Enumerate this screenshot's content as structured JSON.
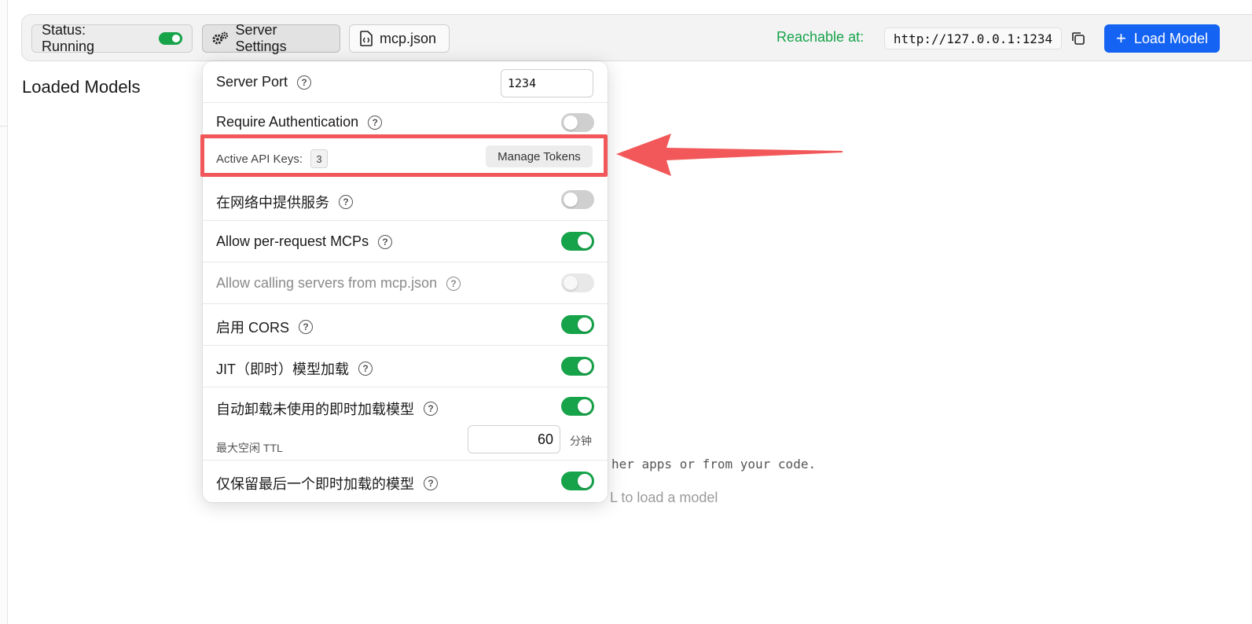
{
  "toolbar": {
    "status_label": "Status: Running",
    "server_settings_label": "Server Settings",
    "mcp_label": "mcp.json",
    "reachable_label": "Reachable at:",
    "url": "http://127.0.0.1:1234",
    "load_model_label": "Load Model"
  },
  "main": {
    "title": "Loaded Models",
    "hint_text": "her apps or from your code.",
    "hint_text_2": "L to load a model"
  },
  "settings": {
    "server_port": {
      "label": "Server Port",
      "value": "1234"
    },
    "require_auth": {
      "label": "Require Authentication",
      "enabled": false
    },
    "api_keys": {
      "label": "Active API Keys:",
      "count": "3",
      "manage_label": "Manage Tokens"
    },
    "serve_network": {
      "label": "在网络中提供服务",
      "enabled": false
    },
    "per_request_mcps": {
      "label": "Allow per-request MCPs",
      "enabled": true
    },
    "calling_servers_mcp": {
      "label": "Allow calling servers from mcp.json",
      "enabled": false,
      "disabled": true
    },
    "cors": {
      "label": "启用 CORS",
      "enabled": true
    },
    "jit": {
      "label": "JIT（即时）模型加载",
      "enabled": true
    },
    "auto_unload": {
      "label": "自动卸载未使用的即时加载模型",
      "enabled": true,
      "ttl_label": "最大空闲 TTL",
      "ttl_value": "60",
      "ttl_unit": "分钟"
    },
    "keep_last": {
      "label": "仅保留最后一个即时加载的模型",
      "enabled": true
    }
  },
  "annotation": {
    "color": "#f25859"
  },
  "colors": {
    "accent_blue": "#1463f3",
    "green": "#16a34a"
  }
}
